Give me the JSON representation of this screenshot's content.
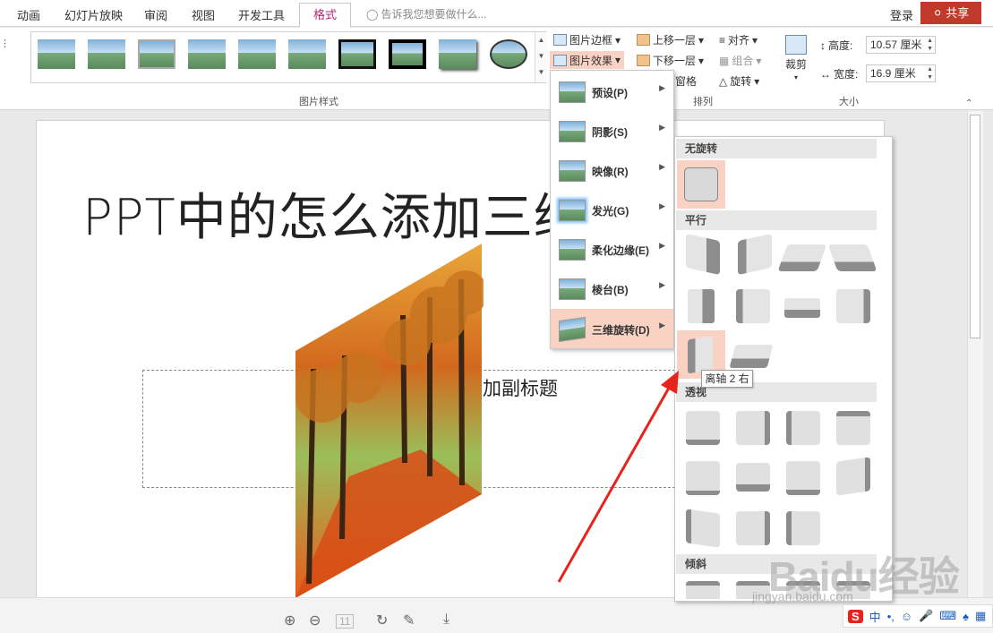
{
  "tabs": [
    "动画",
    "幻灯片放映",
    "审阅",
    "视图",
    "开发工具",
    "格式"
  ],
  "tell_me": "告诉我您想要做什么...",
  "login": "登录",
  "share": "共享",
  "ribbon": {
    "style_group_label": "图片样式",
    "picture_border": "图片边框",
    "picture_effects": "图片效果",
    "bring_forward": "上移一层",
    "send_backward": "下移一层",
    "selection_pane": "窗格",
    "align": "对齐",
    "group": "组合",
    "rotate": "旋转",
    "arrange_label": "排列",
    "crop": "裁剪",
    "height_label": "高度:",
    "height_value": "10.57 厘米",
    "width_label": "宽度:",
    "width_value": "16.9 厘米",
    "size_label": "大小"
  },
  "slide": {
    "title": "PPT中的怎么添加三维",
    "subtitle_fragment": "加副标题"
  },
  "effects_menu": [
    {
      "label": "预设(P)"
    },
    {
      "label": "阴影(S)"
    },
    {
      "label": "映像(R)"
    },
    {
      "label": "发光(G)"
    },
    {
      "label": "柔化边缘(E)"
    },
    {
      "label": "棱台(B)"
    },
    {
      "label": "三维旋转(D)"
    }
  ],
  "rotation_panel": {
    "no_rotation": "无旋转",
    "parallel": "平行",
    "perspective": "透视",
    "oblique": "倾斜",
    "tooltip": "离轴 2 右"
  },
  "watermark": {
    "brand": "Baidu经验",
    "url": "jingyan.baidu.com"
  },
  "ime": {
    "lang": "中"
  },
  "colors": {
    "format_tab": "#b0276b",
    "share_bg": "#c0392b",
    "hover_bg": "#f9d2c4",
    "arrow": "#e8231b"
  }
}
